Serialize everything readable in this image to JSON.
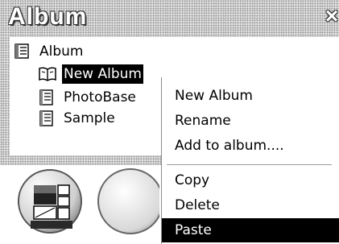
{
  "window": {
    "title": "Album",
    "close_glyph": "×"
  },
  "tree": {
    "root": {
      "label": "Album",
      "icon": "album-list-icon"
    },
    "items": [
      {
        "label": "New Album",
        "icon": "open-book-icon",
        "selected": true
      },
      {
        "label": "PhotoBase",
        "icon": "album-list-icon",
        "selected": false
      },
      {
        "label": "Sample",
        "icon": "album-list-icon",
        "selected": false
      }
    ]
  },
  "context_menu": {
    "items": [
      {
        "label": "New Album"
      },
      {
        "label": "Rename"
      },
      {
        "label": "Add to album...."
      },
      {
        "label": "Copy"
      },
      {
        "label": "Delete"
      },
      {
        "label": "Paste",
        "highlighted": true
      }
    ]
  },
  "toolbar": {
    "buttons": [
      {
        "icon": "layout-grid-icon"
      },
      {
        "icon": "round-button-icon"
      }
    ]
  },
  "colors": {
    "highlight_bg": "#000000",
    "highlight_fg": "#ffffff",
    "frame": "#e6e6e6"
  }
}
